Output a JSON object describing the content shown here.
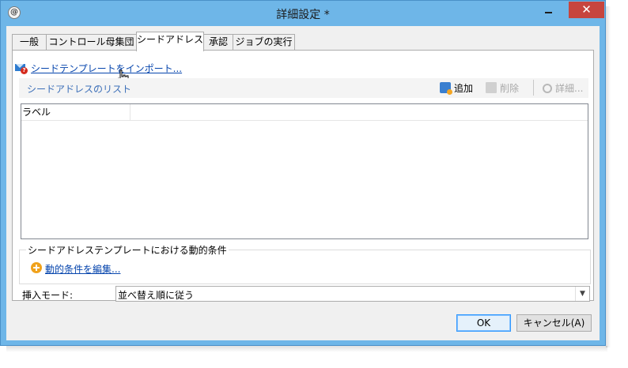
{
  "window": {
    "title": "詳細設定 *",
    "app_icon": "@",
    "buttons": {
      "minimize": "minimize-icon",
      "maximize": "maximize-icon",
      "close": "✕"
    }
  },
  "tabs": [
    {
      "label": "一般"
    },
    {
      "label": "コントロール母集団"
    },
    {
      "label": "シードアドレス",
      "active": true
    },
    {
      "label": "承認"
    },
    {
      "label": "ジョブの実行"
    }
  ],
  "import": {
    "link": "シードテンプレートをインポート..."
  },
  "list": {
    "title": "シードアドレスのリスト",
    "toolbar": {
      "add": "追加",
      "delete": "削除",
      "details": "詳細..."
    },
    "columns": [
      "ラベル"
    ],
    "rows": []
  },
  "dynamic": {
    "legend": "シードアドレステンプレートにおける動的条件",
    "edit_link": "動的条件を編集..."
  },
  "insert_mode": {
    "label": "挿入モード:",
    "value": "並べ替え順に従う"
  },
  "footer": {
    "ok": "OK",
    "cancel": "キャンセル(A)"
  },
  "colors": {
    "window_border": "#6eb6e8",
    "close_button": "#c7453e",
    "link": "#0645ad",
    "list_title": "#3c6fb8"
  }
}
